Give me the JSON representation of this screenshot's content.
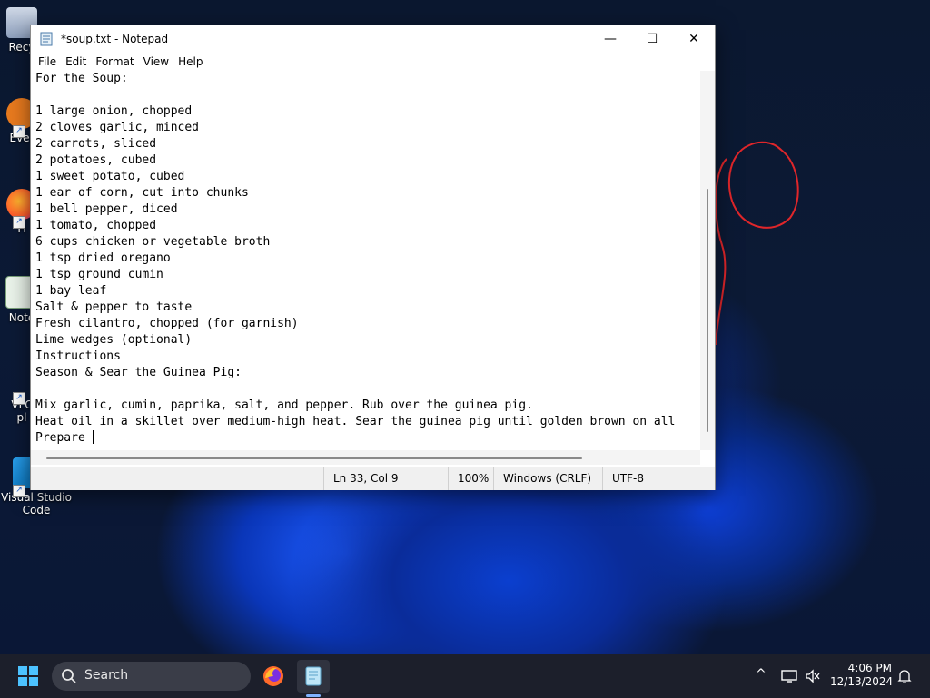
{
  "desktop": {
    "icons": [
      {
        "label": "Recy"
      },
      {
        "label": "Ever"
      },
      {
        "label": "Fi"
      },
      {
        "label": "Note"
      },
      {
        "label": "VLC"
      },
      {
        "label": "pl"
      },
      {
        "label": "Visual Studio"
      },
      {
        "label": "Code"
      }
    ]
  },
  "notepad": {
    "title": "*soup.txt - Notepad",
    "menu": [
      "File",
      "Edit",
      "Format",
      "View",
      "Help"
    ],
    "lines": [
      "For the Soup:",
      "",
      "1 large onion, chopped",
      "2 cloves garlic, minced",
      "2 carrots, sliced",
      "2 potatoes, cubed",
      "1 sweet potato, cubed",
      "1 ear of corn, cut into chunks",
      "1 bell pepper, diced",
      "1 tomato, chopped",
      "6 cups chicken or vegetable broth",
      "1 tsp dried oregano",
      "1 tsp ground cumin",
      "1 bay leaf",
      "Salt & pepper to taste",
      "Fresh cilantro, chopped (for garnish)",
      "Lime wedges (optional)",
      "Instructions",
      "Season & Sear the Guinea Pig:",
      "",
      "Mix garlic, cumin, paprika, salt, and pepper. Rub over the guinea pig.",
      "Heat oil in a skillet over medium-high heat. Sear the guinea pig until golden brown on all",
      "Prepare "
    ],
    "status": {
      "position": "Ln 33, Col 9",
      "zoom": "100%",
      "line_ending": "Windows (CRLF)",
      "encoding": "UTF-8"
    },
    "caption_buttons": {
      "minimize": "—",
      "maximize": "☐",
      "close": "✕"
    }
  },
  "taskbar": {
    "search_label": "Search",
    "time": "4:06 PM",
    "date": "12/13/2024",
    "tray_chevron": "^"
  },
  "colors": {
    "accent": "#7fb3ff",
    "taskbar": "#1c1f2b",
    "doodle": "#e0262a"
  }
}
